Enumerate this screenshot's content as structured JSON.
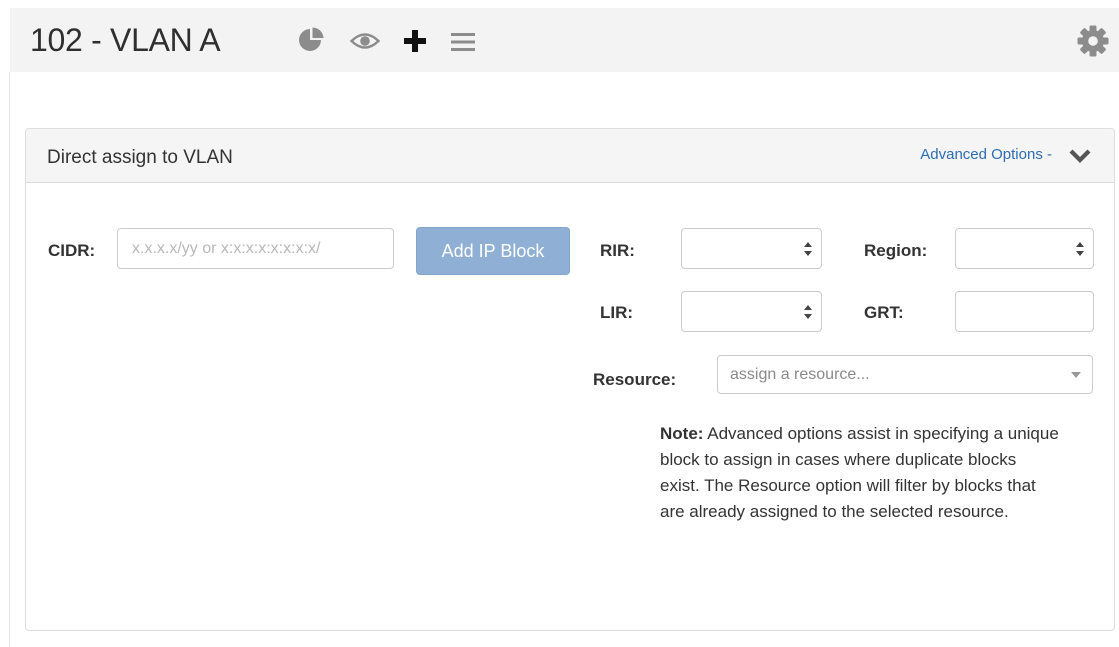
{
  "header": {
    "title": "102 - VLAN A",
    "icons": [
      "pie-chart-icon",
      "eye-icon",
      "plus-icon",
      "menu-icon",
      "gear-icon"
    ]
  },
  "panel": {
    "title": "Direct assign to VLAN",
    "advanced_options_label": "Advanced Options -",
    "chevron": "chevron-down-icon"
  },
  "form": {
    "cidr_label": "CIDR:",
    "cidr_placeholder": "x.x.x.x/yy or x:x:x:x:x:x:x:x/",
    "cidr_value": "",
    "add_button_label": "Add IP Block",
    "rir_label": "RIR:",
    "rir_value": "",
    "region_label": "Region:",
    "region_value": "",
    "lir_label": "LIR:",
    "lir_value": "",
    "grt_label": "GRT:",
    "grt_value": "",
    "resource_label": "Resource:",
    "resource_placeholder": "assign a resource..."
  },
  "note": {
    "bold": "Note:",
    "text": " Advanced options assist in specifying a unique block to assign in cases where duplicate blocks exist. The Resource option will filter by blocks that are already assigned to the selected resource."
  },
  "colors": {
    "header_bg": "#f3f3f3",
    "button_bg": "#8fb0d4",
    "link": "#2c6db3",
    "icon_grey": "#8c8c8c"
  }
}
